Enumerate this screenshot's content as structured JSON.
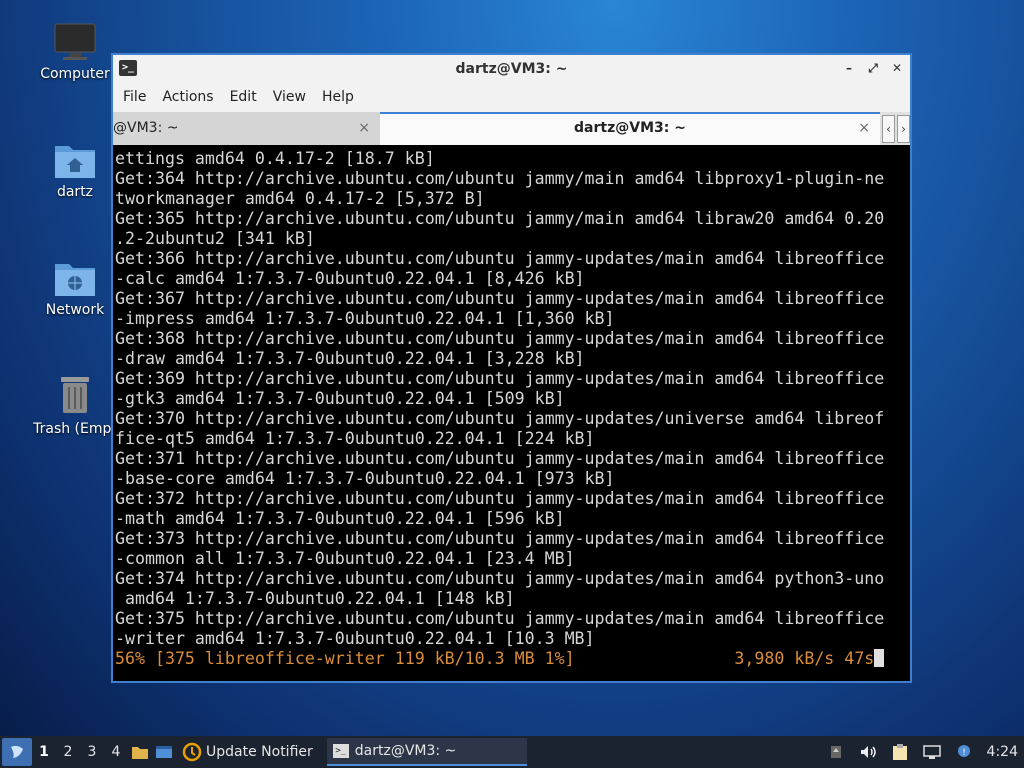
{
  "desktop": {
    "icons": [
      {
        "label": "Computer"
      },
      {
        "label": "dartz"
      },
      {
        "label": "Network"
      },
      {
        "label": "Trash (Empt"
      }
    ]
  },
  "window": {
    "title": "dartz@VM3: ~",
    "menu": [
      "File",
      "Actions",
      "Edit",
      "View",
      "Help"
    ],
    "tabs": [
      {
        "label": "@VM3: ~"
      },
      {
        "label": "dartz@VM3: ~"
      }
    ],
    "close_glyph": "×"
  },
  "terminal": {
    "lines": [
      "ettings amd64 0.4.17-2 [18.7 kB]",
      "Get:364 http://archive.ubuntu.com/ubuntu jammy/main amd64 libproxy1-plugin-ne",
      "tworkmanager amd64 0.4.17-2 [5,372 B]",
      "Get:365 http://archive.ubuntu.com/ubuntu jammy/main amd64 libraw20 amd64 0.20",
      ".2-2ubuntu2 [341 kB]",
      "Get:366 http://archive.ubuntu.com/ubuntu jammy-updates/main amd64 libreoffice",
      "-calc amd64 1:7.3.7-0ubuntu0.22.04.1 [8,426 kB]",
      "Get:367 http://archive.ubuntu.com/ubuntu jammy-updates/main amd64 libreoffice",
      "-impress amd64 1:7.3.7-0ubuntu0.22.04.1 [1,360 kB]",
      "Get:368 http://archive.ubuntu.com/ubuntu jammy-updates/main amd64 libreoffice",
      "-draw amd64 1:7.3.7-0ubuntu0.22.04.1 [3,228 kB]",
      "Get:369 http://archive.ubuntu.com/ubuntu jammy-updates/main amd64 libreoffice",
      "-gtk3 amd64 1:7.3.7-0ubuntu0.22.04.1 [509 kB]",
      "Get:370 http://archive.ubuntu.com/ubuntu jammy-updates/universe amd64 libreof",
      "fice-qt5 amd64 1:7.3.7-0ubuntu0.22.04.1 [224 kB]",
      "Get:371 http://archive.ubuntu.com/ubuntu jammy-updates/main amd64 libreoffice",
      "-base-core amd64 1:7.3.7-0ubuntu0.22.04.1 [973 kB]",
      "Get:372 http://archive.ubuntu.com/ubuntu jammy-updates/main amd64 libreoffice",
      "-math amd64 1:7.3.7-0ubuntu0.22.04.1 [596 kB]",
      "Get:373 http://archive.ubuntu.com/ubuntu jammy-updates/main amd64 libreoffice",
      "-common all 1:7.3.7-0ubuntu0.22.04.1 [23.4 MB]",
      "Get:374 http://archive.ubuntu.com/ubuntu jammy-updates/main amd64 python3-uno",
      " amd64 1:7.3.7-0ubuntu0.22.04.1 [148 kB]",
      "Get:375 http://archive.ubuntu.com/ubuntu jammy-updates/main amd64 libreoffice",
      "-writer amd64 1:7.3.7-0ubuntu0.22.04.1 [10.3 MB]"
    ],
    "progress_line": "56% [375 libreoffice-writer 119 kB/10.3 MB 1%]                3,980 kB/s 47s",
    "text_color": "#d6d6d6",
    "progress_color": "#d98c3a"
  },
  "taskbar": {
    "workspaces": [
      "1",
      "2",
      "3",
      "4"
    ],
    "tasks": [
      {
        "label": "Update Notifier"
      },
      {
        "label": "dartz@VM3: ~"
      }
    ],
    "clock": "4:24"
  },
  "icons": {
    "computer": "monitor-icon",
    "home": "home-folder-icon",
    "network": "network-folder-icon",
    "trash": "trash-icon"
  }
}
